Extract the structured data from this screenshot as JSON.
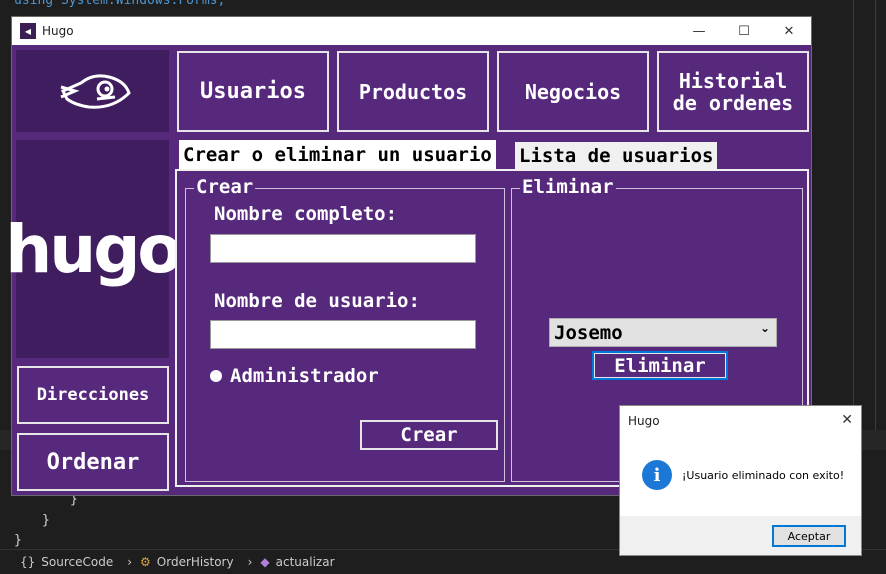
{
  "ide": {
    "code_top": "using System.Windows.Forms;",
    "brace_1": "}",
    "brace_2": "}",
    "brace_3": "}",
    "status": {
      "item1": "SourceCode",
      "item2": "OrderHistory",
      "item3": "actualizar"
    }
  },
  "window": {
    "title": "Hugo",
    "minimize": "—",
    "maximize": "☐",
    "close": "✕"
  },
  "sidebar": {
    "logo_text": "hugo",
    "direcciones": "Direcciones",
    "ordenar": "Ordenar"
  },
  "nav": {
    "usuarios": "Usuarios",
    "productos": "Productos",
    "negocios": "Negocios",
    "historial_line1": "Historial",
    "historial_line2": "de ordenes"
  },
  "tabs": {
    "tab1": "Crear o eliminar un usuario",
    "tab2": "Lista de usuarios"
  },
  "crear": {
    "title": "Crear",
    "nombre_completo": "Nombre completo:",
    "nombre_completo_value": "",
    "nombre_usuario": "Nombre de usuario:",
    "nombre_usuario_value": "",
    "admin_label": "Administrador",
    "button": "Crear"
  },
  "eliminar": {
    "title": "Eliminar",
    "selected_user": "Josemo",
    "button": "Eliminar"
  },
  "message_box": {
    "title": "Hugo",
    "text": "¡Usuario eliminado con exito!",
    "button": "Aceptar",
    "icon": "info-icon"
  },
  "colors": {
    "accent": "#56297d",
    "dark_panel": "#3f1d5e",
    "info_blue": "#1c78d6"
  }
}
